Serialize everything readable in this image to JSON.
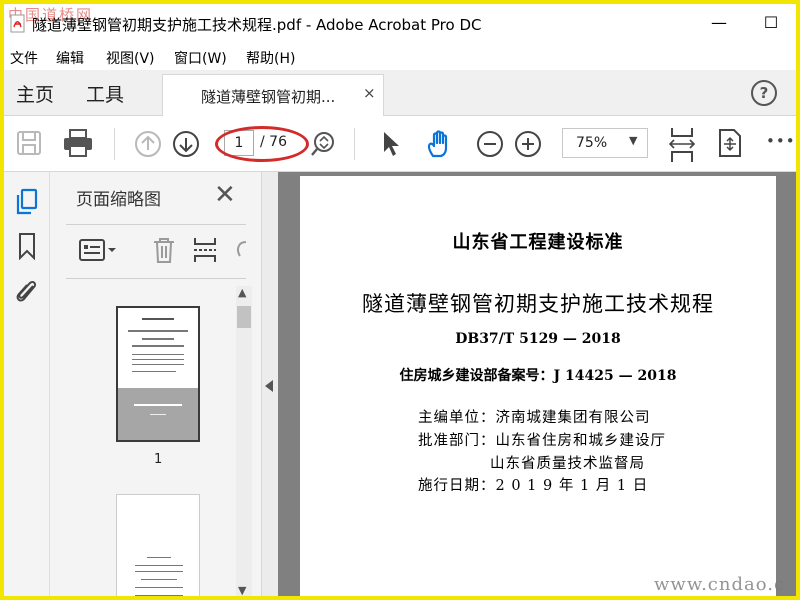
{
  "window": {
    "title": "隧道薄壁钢管初期支护施工技术规程.pdf - Adobe Acrobat Pro DC",
    "minimize": "—",
    "maximize": "☐"
  },
  "watermark_top": "中国道桥网",
  "watermark_bottom": "www.cndao.c",
  "menu": [
    "文件",
    "编辑",
    "视图(V)",
    "窗口(W)",
    "帮助(H)"
  ],
  "tabs": {
    "home": "主页",
    "tools": "工具",
    "document": "隧道薄壁钢管初期...",
    "close": "×",
    "help": "?"
  },
  "toolbar": {
    "current_page": "1",
    "total_pages": "/ 76",
    "zoom": "75%",
    "zoom_caret": "▼",
    "more": "•••"
  },
  "thumbnails_panel": {
    "title": "页面缩略图",
    "close": "✕",
    "thumb1_label": "1",
    "scroll_up": "▲",
    "scroll_down": "▼"
  },
  "document": {
    "header": "山东省工程建设标准",
    "title": "隧道薄壁钢管初期支护施工技术规程",
    "code": "DB37/T 5129 — 2018",
    "record": "住房城乡建设部备案号：J  14425 — 2018",
    "chief_editor": "主编单位：济南城建集团有限公司",
    "approval_1": "批准部门：山东省住房和城乡建设厅",
    "approval_2": "山东省质量技术监督局",
    "date": "施行日期：2 0 1 9 年 1 月 1 日"
  },
  "icons": [
    "pdf-icon",
    "save-icon",
    "print-icon",
    "page-up-icon",
    "page-down-icon",
    "zoom-scroll-icon",
    "select-arrow-icon",
    "hand-icon",
    "zoom-out-icon",
    "zoom-in-icon",
    "fit-width-icon",
    "rotate-page-icon",
    "more-icon",
    "thumbnails-icon",
    "bookmark-icon",
    "attachment-icon",
    "options-icon",
    "delete-icon",
    "insert-page-icon",
    "rotate-icon"
  ],
  "colors": {
    "accent": "#0b74d6",
    "highlight_oval": "#d42a2a",
    "frame_border": "#f2e600"
  }
}
